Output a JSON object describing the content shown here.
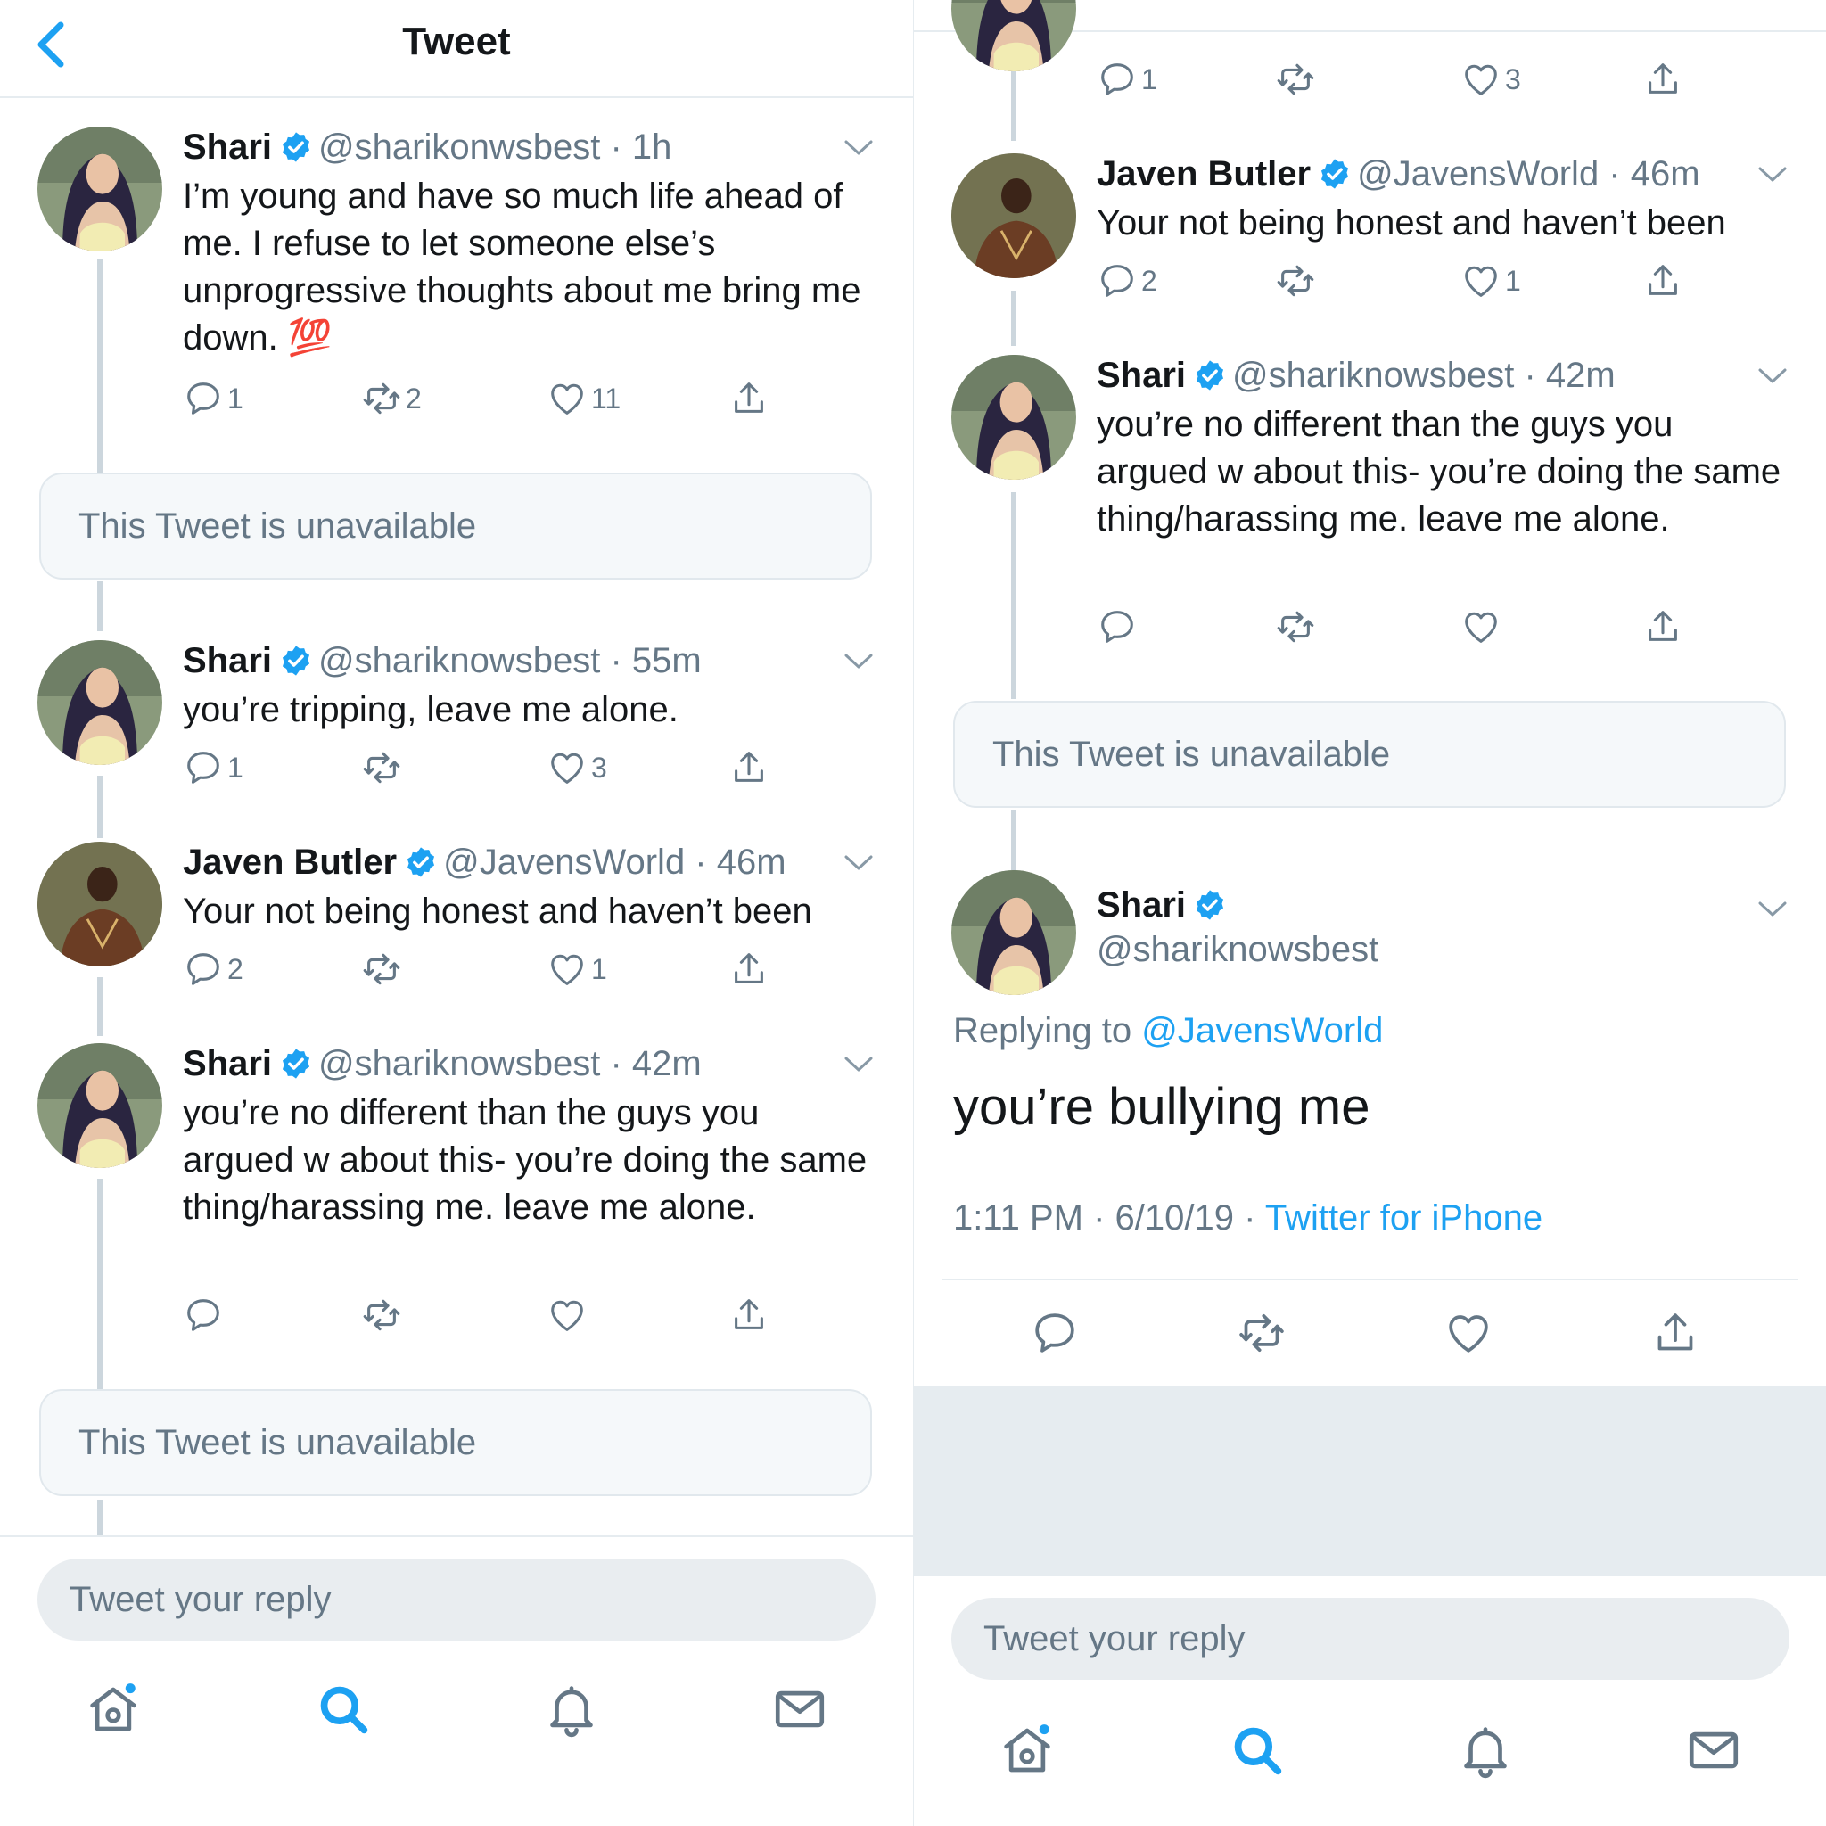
{
  "header": {
    "title": "Tweet",
    "back_icon": "chevron-left-icon"
  },
  "colors": {
    "accent": "#1da1f2",
    "text": "#14171a",
    "muted": "#657786",
    "divider": "#e6ecf0",
    "thread_line": "#ccd6dd"
  },
  "left_thread": {
    "t1": {
      "name": "Shari",
      "handle": "@sharikonwsbest",
      "time": "1h",
      "text": "I’m young and have so much life ahead of me. I refuse to let someone else’s unprogressive thoughts about me bring me down. 💯",
      "replies": "1",
      "retweets": "2",
      "likes": "11"
    },
    "unavailable_1": "This Tweet is unavailable",
    "t2": {
      "name": "Shari",
      "handle": "@shariknowsbest",
      "time": "55m",
      "text": "you’re tripping, leave me alone.",
      "replies": "1",
      "retweets": "",
      "likes": "3"
    },
    "t3": {
      "name": "Javen Butler",
      "handle": "@JavensWorld",
      "time": "46m",
      "text": "Your not being honest and haven’t been",
      "replies": "2",
      "retweets": "",
      "likes": "1"
    },
    "t4": {
      "name": "Shari",
      "handle": "@shariknowsbest",
      "time": "42m",
      "text": "you’re no different than the guys you argued w about this- you’re doing the same thing/harassing me. leave me alone.",
      "replies": "",
      "retweets": "",
      "likes": ""
    },
    "unavailable_2": "This Tweet is unavailable",
    "reply_placeholder": "Tweet your reply"
  },
  "right_thread": {
    "top_counts": {
      "replies": "1",
      "retweets": "",
      "likes": "3"
    },
    "t3": {
      "name": "Javen Butler",
      "handle": "@JavensWorld",
      "time": "46m",
      "text": "Your not being honest and haven’t been",
      "replies": "2",
      "retweets": "",
      "likes": "1"
    },
    "t4": {
      "name": "Shari",
      "handle": "@shariknowsbest",
      "time": "42m",
      "text": "you’re no different than the guys you argued w about this- you’re doing the same thing/harassing me. leave me alone."
    },
    "unavailable": "This Tweet is unavailable",
    "detail": {
      "name": "Shari",
      "handle": "@shariknowsbest",
      "replying_label": "Replying to",
      "replying_to": "@JavensWorld",
      "text": "you’re bullying me",
      "timestamp": "1:11 PM · 6/10/19 · ",
      "source": "Twitter for iPhone"
    },
    "reply_placeholder": "Tweet your reply"
  },
  "icons": [
    "reply-icon",
    "retweet-icon",
    "like-icon",
    "share-icon",
    "verified-badge-icon",
    "chevron-down-icon",
    "home-icon",
    "search-icon",
    "notifications-bell-icon",
    "messages-mail-icon"
  ]
}
